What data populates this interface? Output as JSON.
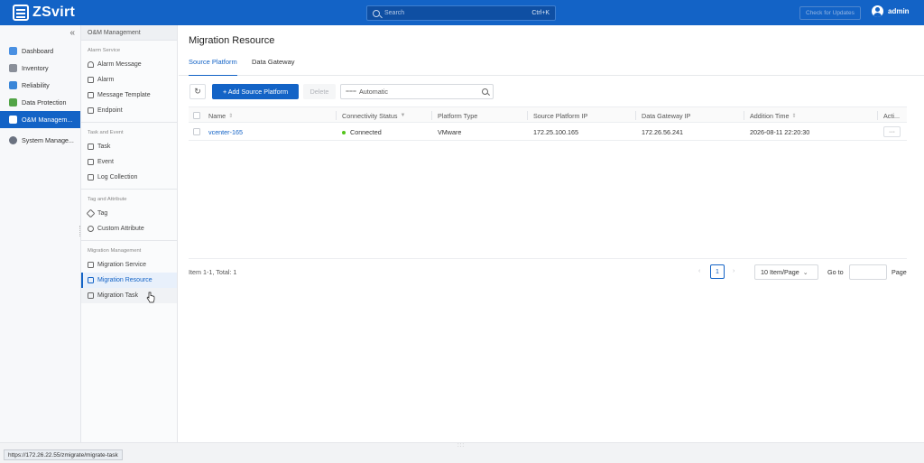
{
  "header": {
    "app_name": "ZSvirt",
    "search_placeholder": "Search",
    "search_shortcut": "Ctrl+K",
    "check_updates": "Check for Updates",
    "user": "admin"
  },
  "nav1": {
    "collapse": "«",
    "items": [
      {
        "label": "Dashboard",
        "icon": "dashboard-icon",
        "color": "#4a90e2"
      },
      {
        "label": "Inventory",
        "icon": "inventory-icon",
        "color": "#8a8f99"
      },
      {
        "label": "Reliability",
        "icon": "reliability-icon",
        "color": "#3a86d8"
      },
      {
        "label": "Data Protection",
        "icon": "data-protection-icon",
        "color": "#52a447"
      },
      {
        "label": "O&M Managem...",
        "icon": "om-management-icon",
        "color": "#ffffff"
      },
      {
        "label": "System Manage...",
        "icon": "system-management-icon",
        "color": "#6b7280"
      }
    ]
  },
  "nav2": {
    "title": "O&M Management",
    "groups": [
      {
        "title": "Alarm Service",
        "items": [
          "Alarm Message",
          "Alarm",
          "Message Template",
          "Endpoint"
        ]
      },
      {
        "title": "Task and Event",
        "items": [
          "Task",
          "Event",
          "Log Collection"
        ]
      },
      {
        "title": "Tag and Attribute",
        "items": [
          "Tag",
          "Custom Attribute"
        ]
      },
      {
        "title": "Migration Management",
        "items": [
          "Migration Service",
          "Migration Resource",
          "Migration Task"
        ]
      }
    ]
  },
  "main": {
    "title": "Migration Resource",
    "tabs": [
      "Source Platform",
      "Data Gateway"
    ],
    "toolbar": {
      "refresh": "↻",
      "add": "+ Add Source Platform",
      "delete": "Delete",
      "filter": "Automatic"
    },
    "columns": [
      "Name",
      "Connectivity Status",
      "Platform Type",
      "Source Platform IP",
      "Data Gateway IP",
      "Addition Time",
      "Acti..."
    ],
    "rows": [
      {
        "name": "vcenter-165",
        "status": "Connected",
        "type": "VMware",
        "source_ip": "172.25.100.165",
        "gateway_ip": "172.26.56.241",
        "time": "2026-08-11 22:20:30",
        "action": "···"
      }
    ],
    "pagination": {
      "total": "Item 1-1, Total: 1",
      "prev": "‹",
      "current": "1",
      "next": "›",
      "page_size": "10 Item/Page",
      "goto": "Go to",
      "page": "Page"
    }
  },
  "statusbar": {
    "url": "https://172.26.22.55/zmigrate/migrate-task",
    "handle": ":::"
  },
  "colors": {
    "accent": "#1363c6",
    "connected": "#52c41a"
  }
}
